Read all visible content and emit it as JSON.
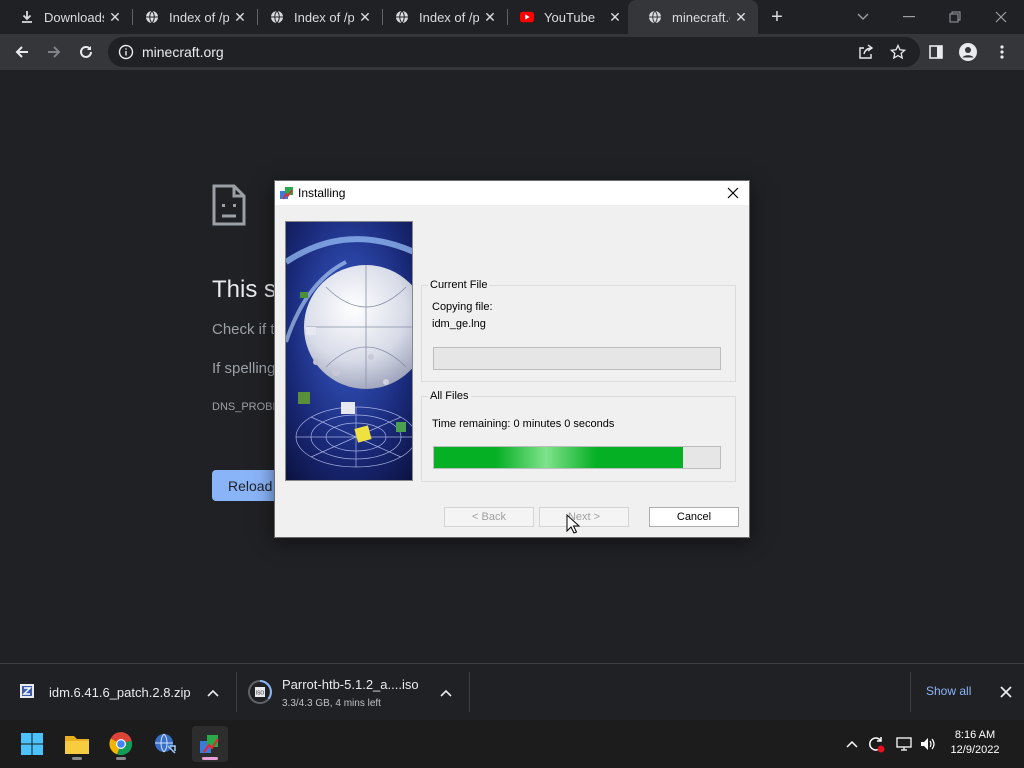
{
  "tabs": [
    {
      "label": "Downloads",
      "icon": "download-icon"
    },
    {
      "label": "Index of /p",
      "icon": "globe-icon"
    },
    {
      "label": "Index of /p",
      "icon": "globe-icon"
    },
    {
      "label": "Index of /p",
      "icon": "globe-icon"
    },
    {
      "label": "YouTube",
      "icon": "youtube-icon"
    },
    {
      "label": "minecraft.o",
      "icon": "globe-icon"
    }
  ],
  "address": {
    "url": "minecraft.org"
  },
  "error_page": {
    "title": "This s",
    "line1": "Check if t",
    "line2": "If spelling",
    "code": "DNS_PROBE",
    "reload_label": "Reload"
  },
  "installer": {
    "title": "Installing",
    "current_file": {
      "legend": "Current File",
      "action": "Copying file:",
      "filename": "idm_ge.lng",
      "progress": 0
    },
    "all_files": {
      "legend": "All Files",
      "time_remaining": "Time remaining: 0 minutes 0 seconds",
      "progress": 0.87
    },
    "buttons": {
      "back": "< Back",
      "next": "Next >",
      "cancel": "Cancel"
    }
  },
  "downloads": [
    {
      "name": "idm.6.41.6_patch.2.8.zip",
      "status": ""
    },
    {
      "name": "Parrot-htb-5.1.2_a....iso",
      "status": "3.3/4.3 GB, 4 mins left"
    }
  ],
  "shelf": {
    "show_all": "Show all"
  },
  "taskbar": {
    "time": "8:16 AM",
    "date": "12/9/2022"
  },
  "colors": {
    "accent": "#8ab4f8",
    "progress_green": "#06b025",
    "dark_bg": "#202124"
  }
}
